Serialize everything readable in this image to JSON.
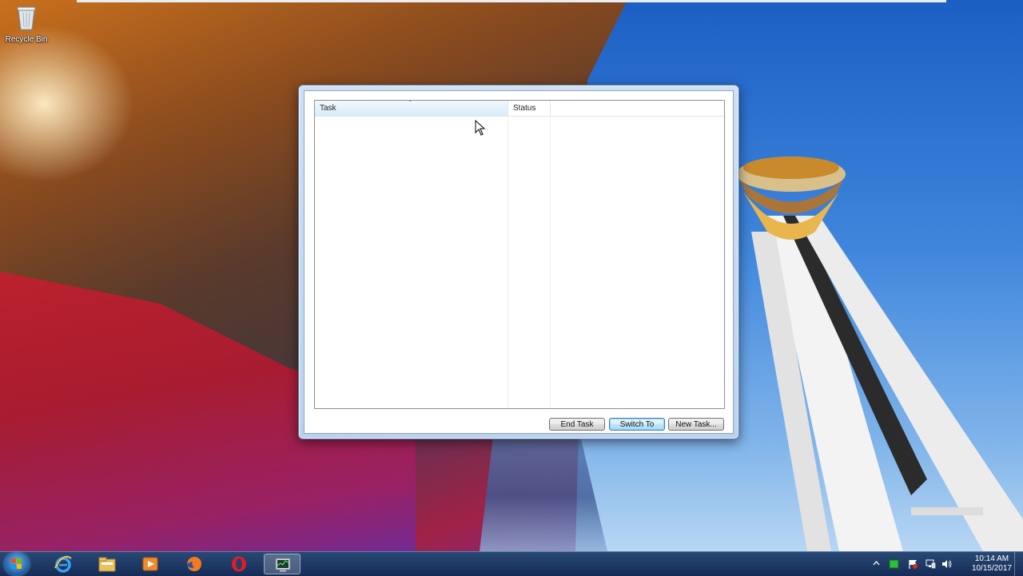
{
  "desktop": {
    "icons": [
      {
        "label": "Recycle Bin",
        "icon": "recycle-bin-icon"
      }
    ]
  },
  "window": {
    "listview": {
      "columns": [
        {
          "label": "Task",
          "sorted": true
        },
        {
          "label": "Status",
          "sorted": false
        }
      ],
      "rows": []
    },
    "buttons": {
      "end_task": "End Task",
      "switch_to": "Switch To",
      "new_task": "New Task..."
    }
  },
  "taskbar": {
    "pinned": [
      {
        "name": "internet-explorer-icon"
      },
      {
        "name": "windows-explorer-icon"
      },
      {
        "name": "media-player-icon"
      },
      {
        "name": "firefox-icon"
      },
      {
        "name": "opera-icon"
      },
      {
        "name": "task-manager-icon",
        "active": true
      }
    ],
    "clock": {
      "time": "10:14 AM",
      "date": "10/15/2017"
    }
  },
  "colors": {
    "sorted_header": "#d7ecfa",
    "default_button_border": "#3c7fb1",
    "taskbar": "#1e3a66"
  }
}
